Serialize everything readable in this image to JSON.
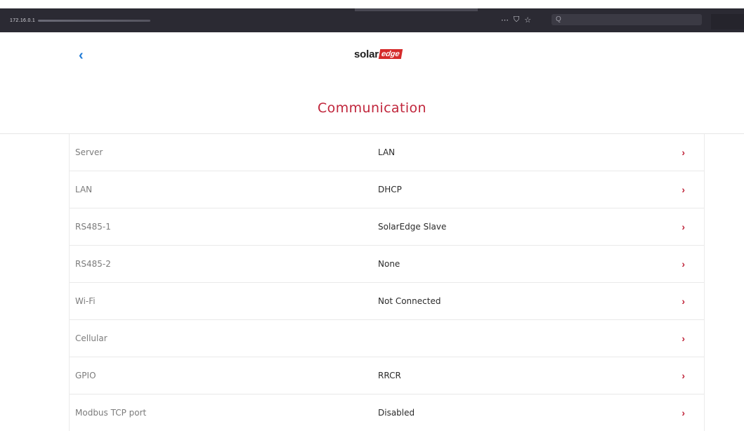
{
  "browser": {
    "url": "172.16.0.1",
    "search_placeholder": "Q",
    "toolbar_icons": [
      "more-icon",
      "pocket-icon",
      "star-icon"
    ]
  },
  "header": {
    "back_icon": "chevron-left-icon",
    "logo_part1": "solar",
    "logo_part2": "edge"
  },
  "page": {
    "title": "Communication"
  },
  "rows": [
    {
      "label": "Server",
      "value": "LAN"
    },
    {
      "label": "LAN",
      "value": "DHCP"
    },
    {
      "label": "RS485-1",
      "value": "SolarEdge Slave"
    },
    {
      "label": "RS485-2",
      "value": "None"
    },
    {
      "label": "Wi-Fi",
      "value": "Not Connected"
    },
    {
      "label": "Cellular",
      "value": ""
    },
    {
      "label": "GPIO",
      "value": "RRCR"
    },
    {
      "label": "Modbus TCP port",
      "value": "Disabled"
    }
  ],
  "colors": {
    "accent": "#c0253b",
    "back": "#1e7ad6"
  }
}
